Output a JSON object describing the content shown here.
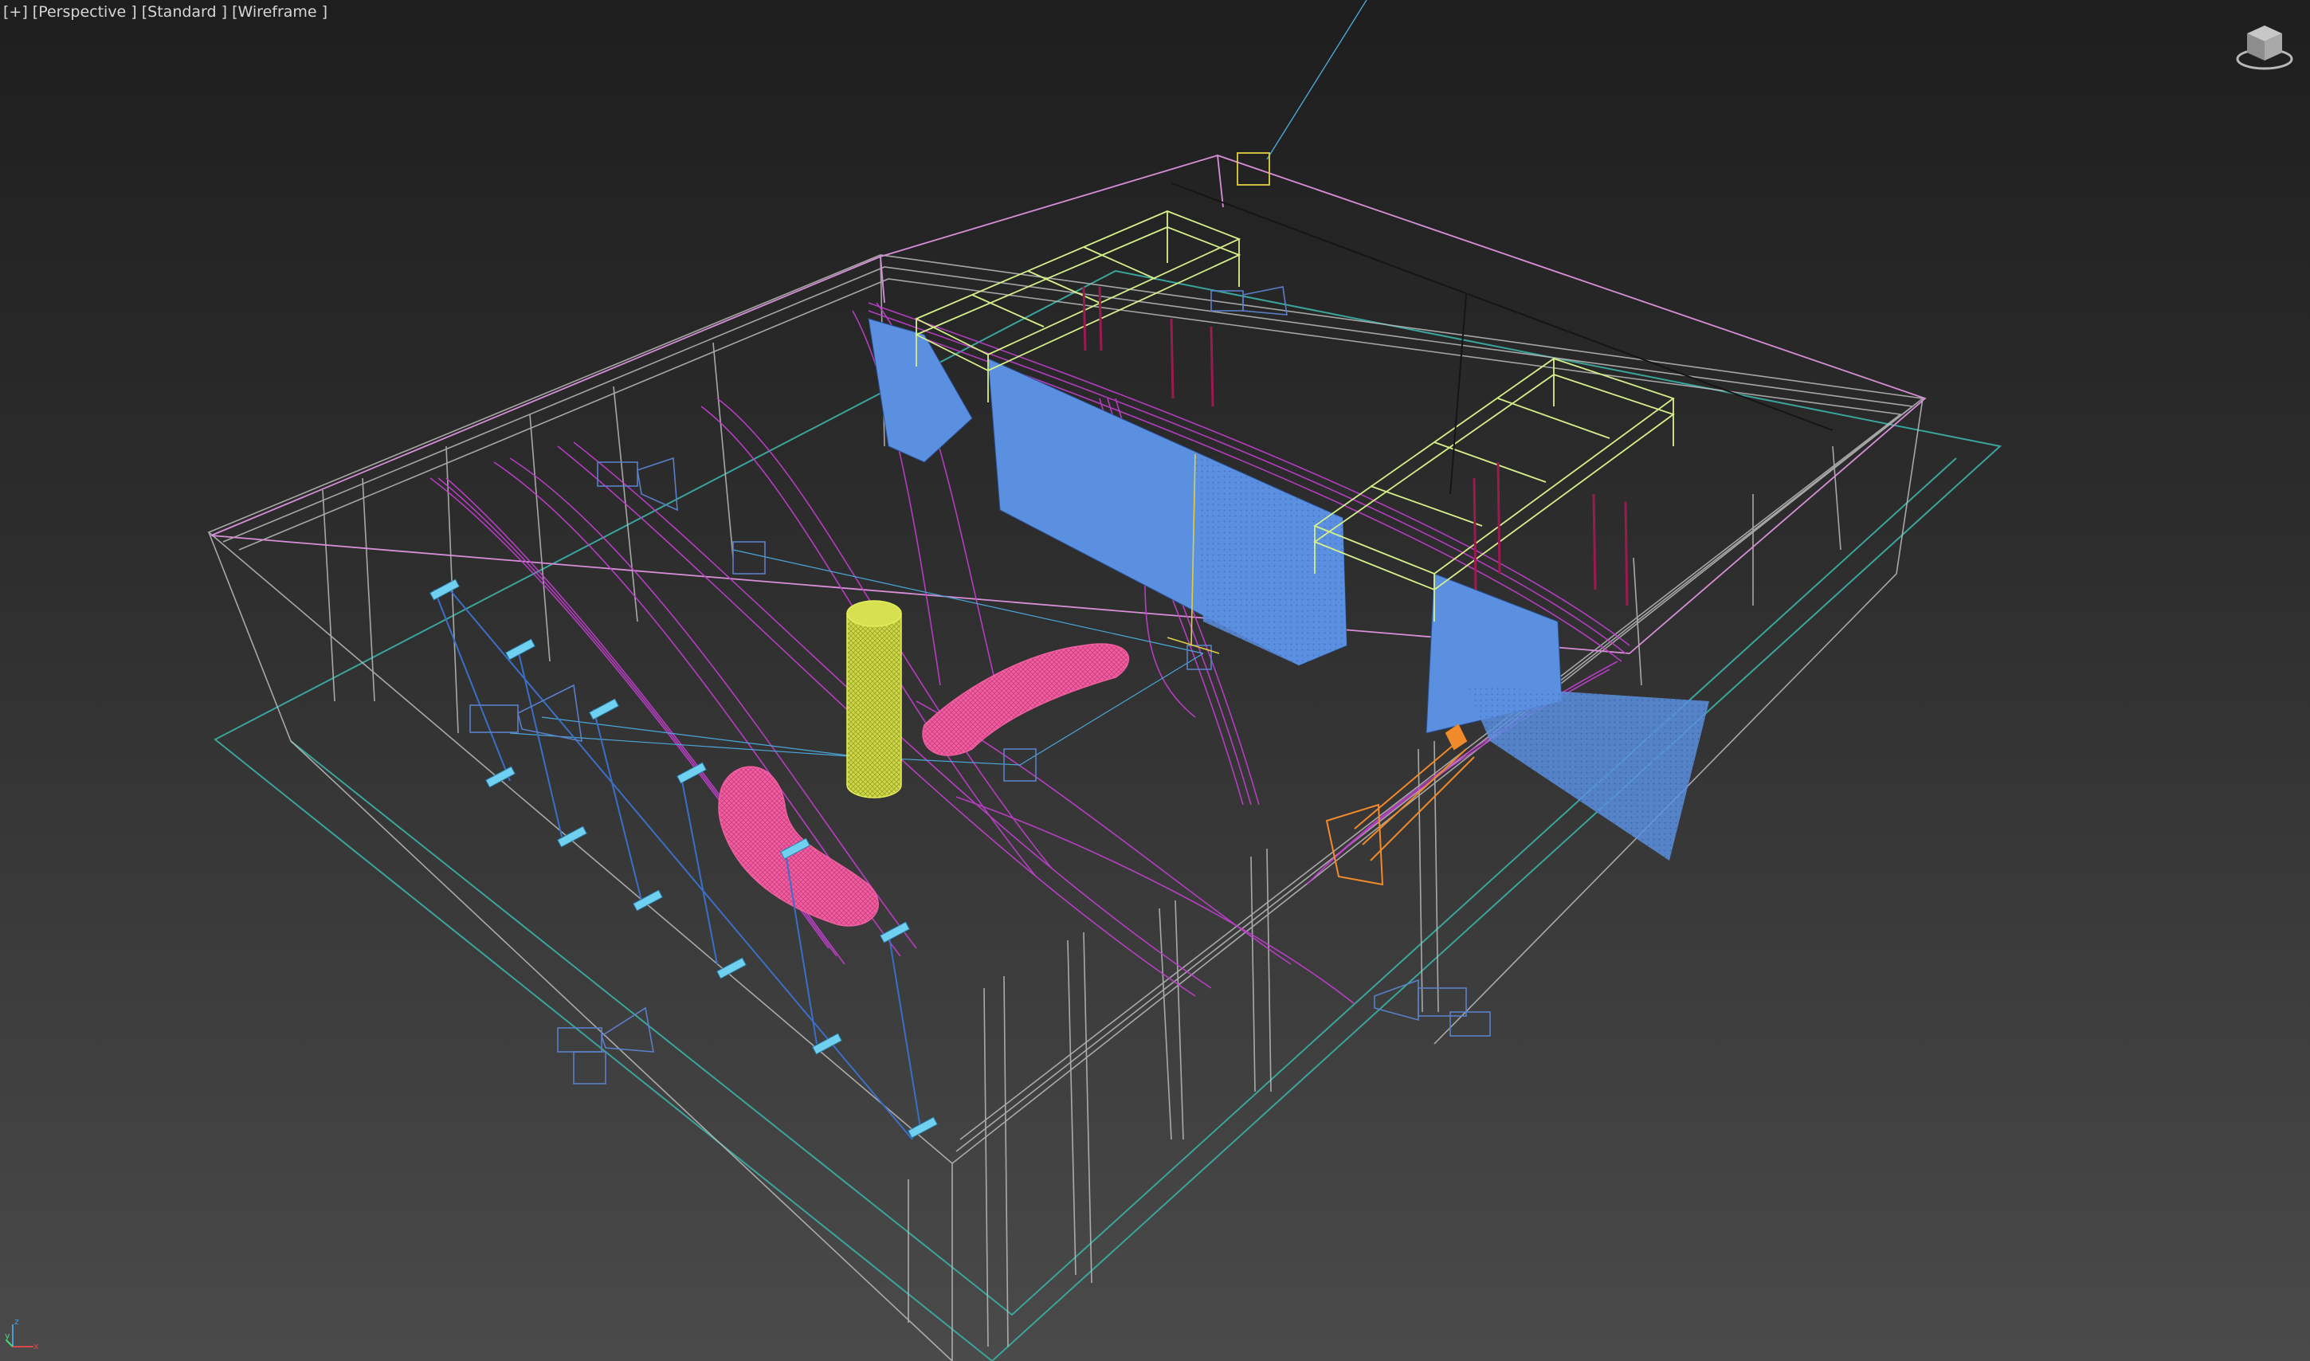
{
  "viewport": {
    "plus_label": "[+]",
    "view_label": "[Perspective ]",
    "shading_label": "[Standard ]",
    "display_label": "[Wireframe ]"
  },
  "viewcube": {
    "icon": "viewcube-icon"
  },
  "axis_tripod": {
    "icon": "axis-tripod-icon",
    "x_label": "x",
    "y_label": "y",
    "z_label": "z"
  },
  "colors": {
    "background_top": "#1e1e1e",
    "background_bottom": "#4a4a4a",
    "building_outline": "#c9c9c9",
    "roof_outline": "#d88fd8",
    "cable_color": "#c33fd0",
    "panel_fill": "#5b8fe0",
    "light_truss": "#d7f08a",
    "pink_blobs": "#f05fa0",
    "yellow_cylinder": "#e4ef5a",
    "orange_light": "#f08a2a",
    "camera_blue": "#5a7fc8",
    "ground_teal": "#3aa59a"
  }
}
